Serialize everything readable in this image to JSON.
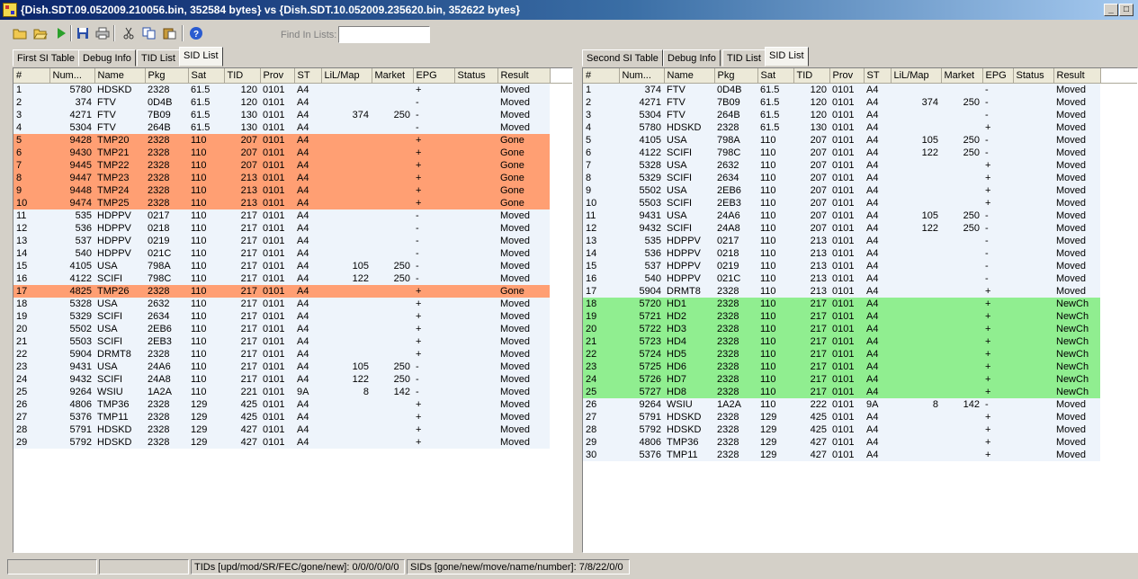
{
  "window": {
    "title": "{Dish.SDT.09.052009.210056.bin, 352584 bytes} vs {Dish.SDT.10.052009.235620.bin, 352622 bytes}",
    "minimize_glyph": "_",
    "maximize_glyph": "□"
  },
  "toolbar": {
    "icons": [
      "open-folder-icon",
      "open-icon",
      "run-icon",
      "save-icon",
      "print-icon",
      "cut-icon",
      "copy-icon",
      "paste-icon",
      "help-icon"
    ],
    "find_label": "Find In Lists:",
    "find_value": ""
  },
  "left_tabs": [
    "First SI Table",
    "Debug Info",
    "TID List",
    "SID List"
  ],
  "right_tabs": [
    "Second SI Table",
    "Debug Info",
    "TID List",
    "SID List"
  ],
  "active_tab": "SID List",
  "columns": [
    "#",
    "Num...",
    "Name",
    "Pkg",
    "Sat",
    "TID",
    "Prov",
    "ST",
    "LiL/Map",
    "Market",
    "EPG",
    "Status",
    "Result"
  ],
  "colors": {
    "gone": "#ff9f73",
    "newch": "#90ee90",
    "normal": "#eef4fb"
  },
  "left_rows": [
    {
      "n": "1",
      "num": "5780",
      "name": "HDSKD",
      "pkg": "2328",
      "sat": "61.5",
      "tid": "120",
      "prov": "0101",
      "st": "A4",
      "lil": "",
      "market": "",
      "epg": "+",
      "status": "",
      "result": "Moved"
    },
    {
      "n": "2",
      "num": "374",
      "name": "FTV",
      "pkg": "0D4B",
      "sat": "61.5",
      "tid": "120",
      "prov": "0101",
      "st": "A4",
      "lil": "",
      "market": "",
      "epg": "-",
      "status": "",
      "result": "Moved"
    },
    {
      "n": "3",
      "num": "4271",
      "name": "FTV",
      "pkg": "7B09",
      "sat": "61.5",
      "tid": "130",
      "prov": "0101",
      "st": "A4",
      "lil": "374",
      "market": "250",
      "epg": "-",
      "status": "",
      "result": "Moved"
    },
    {
      "n": "4",
      "num": "5304",
      "name": "FTV",
      "pkg": "264B",
      "sat": "61.5",
      "tid": "130",
      "prov": "0101",
      "st": "A4",
      "lil": "",
      "market": "",
      "epg": "-",
      "status": "",
      "result": "Moved"
    },
    {
      "n": "5",
      "num": "9428",
      "name": "TMP20",
      "pkg": "2328",
      "sat": "110",
      "tid": "207",
      "prov": "0101",
      "st": "A4",
      "lil": "",
      "market": "",
      "epg": "+",
      "status": "",
      "result": "Gone"
    },
    {
      "n": "6",
      "num": "9430",
      "name": "TMP21",
      "pkg": "2328",
      "sat": "110",
      "tid": "207",
      "prov": "0101",
      "st": "A4",
      "lil": "",
      "market": "",
      "epg": "+",
      "status": "",
      "result": "Gone"
    },
    {
      "n": "7",
      "num": "9445",
      "name": "TMP22",
      "pkg": "2328",
      "sat": "110",
      "tid": "207",
      "prov": "0101",
      "st": "A4",
      "lil": "",
      "market": "",
      "epg": "+",
      "status": "",
      "result": "Gone"
    },
    {
      "n": "8",
      "num": "9447",
      "name": "TMP23",
      "pkg": "2328",
      "sat": "110",
      "tid": "213",
      "prov": "0101",
      "st": "A4",
      "lil": "",
      "market": "",
      "epg": "+",
      "status": "",
      "result": "Gone"
    },
    {
      "n": "9",
      "num": "9448",
      "name": "TMP24",
      "pkg": "2328",
      "sat": "110",
      "tid": "213",
      "prov": "0101",
      "st": "A4",
      "lil": "",
      "market": "",
      "epg": "+",
      "status": "",
      "result": "Gone"
    },
    {
      "n": "10",
      "num": "9474",
      "name": "TMP25",
      "pkg": "2328",
      "sat": "110",
      "tid": "213",
      "prov": "0101",
      "st": "A4",
      "lil": "",
      "market": "",
      "epg": "+",
      "status": "",
      "result": "Gone"
    },
    {
      "n": "11",
      "num": "535",
      "name": "HDPPV",
      "pkg": "0217",
      "sat": "110",
      "tid": "217",
      "prov": "0101",
      "st": "A4",
      "lil": "",
      "market": "",
      "epg": "-",
      "status": "",
      "result": "Moved"
    },
    {
      "n": "12",
      "num": "536",
      "name": "HDPPV",
      "pkg": "0218",
      "sat": "110",
      "tid": "217",
      "prov": "0101",
      "st": "A4",
      "lil": "",
      "market": "",
      "epg": "-",
      "status": "",
      "result": "Moved"
    },
    {
      "n": "13",
      "num": "537",
      "name": "HDPPV",
      "pkg": "0219",
      "sat": "110",
      "tid": "217",
      "prov": "0101",
      "st": "A4",
      "lil": "",
      "market": "",
      "epg": "-",
      "status": "",
      "result": "Moved"
    },
    {
      "n": "14",
      "num": "540",
      "name": "HDPPV",
      "pkg": "021C",
      "sat": "110",
      "tid": "217",
      "prov": "0101",
      "st": "A4",
      "lil": "",
      "market": "",
      "epg": "-",
      "status": "",
      "result": "Moved"
    },
    {
      "n": "15",
      "num": "4105",
      "name": "USA",
      "pkg": "798A",
      "sat": "110",
      "tid": "217",
      "prov": "0101",
      "st": "A4",
      "lil": "105",
      "market": "250",
      "epg": "-",
      "status": "",
      "result": "Moved"
    },
    {
      "n": "16",
      "num": "4122",
      "name": "SCIFI",
      "pkg": "798C",
      "sat": "110",
      "tid": "217",
      "prov": "0101",
      "st": "A4",
      "lil": "122",
      "market": "250",
      "epg": "-",
      "status": "",
      "result": "Moved"
    },
    {
      "n": "17",
      "num": "4825",
      "name": "TMP26",
      "pkg": "2328",
      "sat": "110",
      "tid": "217",
      "prov": "0101",
      "st": "A4",
      "lil": "",
      "market": "",
      "epg": "+",
      "status": "",
      "result": "Gone"
    },
    {
      "n": "18",
      "num": "5328",
      "name": "USA",
      "pkg": "2632",
      "sat": "110",
      "tid": "217",
      "prov": "0101",
      "st": "A4",
      "lil": "",
      "market": "",
      "epg": "+",
      "status": "",
      "result": "Moved"
    },
    {
      "n": "19",
      "num": "5329",
      "name": "SCIFI",
      "pkg": "2634",
      "sat": "110",
      "tid": "217",
      "prov": "0101",
      "st": "A4",
      "lil": "",
      "market": "",
      "epg": "+",
      "status": "",
      "result": "Moved"
    },
    {
      "n": "20",
      "num": "5502",
      "name": "USA",
      "pkg": "2EB6",
      "sat": "110",
      "tid": "217",
      "prov": "0101",
      "st": "A4",
      "lil": "",
      "market": "",
      "epg": "+",
      "status": "",
      "result": "Moved"
    },
    {
      "n": "21",
      "num": "5503",
      "name": "SCIFI",
      "pkg": "2EB3",
      "sat": "110",
      "tid": "217",
      "prov": "0101",
      "st": "A4",
      "lil": "",
      "market": "",
      "epg": "+",
      "status": "",
      "result": "Moved"
    },
    {
      "n": "22",
      "num": "5904",
      "name": "DRMT8",
      "pkg": "2328",
      "sat": "110",
      "tid": "217",
      "prov": "0101",
      "st": "A4",
      "lil": "",
      "market": "",
      "epg": "+",
      "status": "",
      "result": "Moved"
    },
    {
      "n": "23",
      "num": "9431",
      "name": "USA",
      "pkg": "24A6",
      "sat": "110",
      "tid": "217",
      "prov": "0101",
      "st": "A4",
      "lil": "105",
      "market": "250",
      "epg": "-",
      "status": "",
      "result": "Moved"
    },
    {
      "n": "24",
      "num": "9432",
      "name": "SCIFI",
      "pkg": "24A8",
      "sat": "110",
      "tid": "217",
      "prov": "0101",
      "st": "A4",
      "lil": "122",
      "market": "250",
      "epg": "-",
      "status": "",
      "result": "Moved"
    },
    {
      "n": "25",
      "num": "9264",
      "name": "WSIU",
      "pkg": "1A2A",
      "sat": "110",
      "tid": "221",
      "prov": "0101",
      "st": "9A",
      "lil": "8",
      "market": "142",
      "epg": "-",
      "status": "",
      "result": "Moved"
    },
    {
      "n": "26",
      "num": "4806",
      "name": "TMP36",
      "pkg": "2328",
      "sat": "129",
      "tid": "425",
      "prov": "0101",
      "st": "A4",
      "lil": "",
      "market": "",
      "epg": "+",
      "status": "",
      "result": "Moved"
    },
    {
      "n": "27",
      "num": "5376",
      "name": "TMP11",
      "pkg": "2328",
      "sat": "129",
      "tid": "425",
      "prov": "0101",
      "st": "A4",
      "lil": "",
      "market": "",
      "epg": "+",
      "status": "",
      "result": "Moved"
    },
    {
      "n": "28",
      "num": "5791",
      "name": "HDSKD",
      "pkg": "2328",
      "sat": "129",
      "tid": "427",
      "prov": "0101",
      "st": "A4",
      "lil": "",
      "market": "",
      "epg": "+",
      "status": "",
      "result": "Moved"
    },
    {
      "n": "29",
      "num": "5792",
      "name": "HDSKD",
      "pkg": "2328",
      "sat": "129",
      "tid": "427",
      "prov": "0101",
      "st": "A4",
      "lil": "",
      "market": "",
      "epg": "+",
      "status": "",
      "result": "Moved"
    }
  ],
  "right_rows": [
    {
      "n": "1",
      "num": "374",
      "name": "FTV",
      "pkg": "0D4B",
      "sat": "61.5",
      "tid": "120",
      "prov": "0101",
      "st": "A4",
      "lil": "",
      "market": "",
      "epg": "-",
      "status": "",
      "result": "Moved"
    },
    {
      "n": "2",
      "num": "4271",
      "name": "FTV",
      "pkg": "7B09",
      "sat": "61.5",
      "tid": "120",
      "prov": "0101",
      "st": "A4",
      "lil": "374",
      "market": "250",
      "epg": "-",
      "status": "",
      "result": "Moved"
    },
    {
      "n": "3",
      "num": "5304",
      "name": "FTV",
      "pkg": "264B",
      "sat": "61.5",
      "tid": "120",
      "prov": "0101",
      "st": "A4",
      "lil": "",
      "market": "",
      "epg": "-",
      "status": "",
      "result": "Moved"
    },
    {
      "n": "4",
      "num": "5780",
      "name": "HDSKD",
      "pkg": "2328",
      "sat": "61.5",
      "tid": "130",
      "prov": "0101",
      "st": "A4",
      "lil": "",
      "market": "",
      "epg": "+",
      "status": "",
      "result": "Moved"
    },
    {
      "n": "5",
      "num": "4105",
      "name": "USA",
      "pkg": "798A",
      "sat": "110",
      "tid": "207",
      "prov": "0101",
      "st": "A4",
      "lil": "105",
      "market": "250",
      "epg": "-",
      "status": "",
      "result": "Moved"
    },
    {
      "n": "6",
      "num": "4122",
      "name": "SCIFI",
      "pkg": "798C",
      "sat": "110",
      "tid": "207",
      "prov": "0101",
      "st": "A4",
      "lil": "122",
      "market": "250",
      "epg": "-",
      "status": "",
      "result": "Moved"
    },
    {
      "n": "7",
      "num": "5328",
      "name": "USA",
      "pkg": "2632",
      "sat": "110",
      "tid": "207",
      "prov": "0101",
      "st": "A4",
      "lil": "",
      "market": "",
      "epg": "+",
      "status": "",
      "result": "Moved"
    },
    {
      "n": "8",
      "num": "5329",
      "name": "SCIFI",
      "pkg": "2634",
      "sat": "110",
      "tid": "207",
      "prov": "0101",
      "st": "A4",
      "lil": "",
      "market": "",
      "epg": "+",
      "status": "",
      "result": "Moved"
    },
    {
      "n": "9",
      "num": "5502",
      "name": "USA",
      "pkg": "2EB6",
      "sat": "110",
      "tid": "207",
      "prov": "0101",
      "st": "A4",
      "lil": "",
      "market": "",
      "epg": "+",
      "status": "",
      "result": "Moved"
    },
    {
      "n": "10",
      "num": "5503",
      "name": "SCIFI",
      "pkg": "2EB3",
      "sat": "110",
      "tid": "207",
      "prov": "0101",
      "st": "A4",
      "lil": "",
      "market": "",
      "epg": "+",
      "status": "",
      "result": "Moved"
    },
    {
      "n": "11",
      "num": "9431",
      "name": "USA",
      "pkg": "24A6",
      "sat": "110",
      "tid": "207",
      "prov": "0101",
      "st": "A4",
      "lil": "105",
      "market": "250",
      "epg": "-",
      "status": "",
      "result": "Moved"
    },
    {
      "n": "12",
      "num": "9432",
      "name": "SCIFI",
      "pkg": "24A8",
      "sat": "110",
      "tid": "207",
      "prov": "0101",
      "st": "A4",
      "lil": "122",
      "market": "250",
      "epg": "-",
      "status": "",
      "result": "Moved"
    },
    {
      "n": "13",
      "num": "535",
      "name": "HDPPV",
      "pkg": "0217",
      "sat": "110",
      "tid": "213",
      "prov": "0101",
      "st": "A4",
      "lil": "",
      "market": "",
      "epg": "-",
      "status": "",
      "result": "Moved"
    },
    {
      "n": "14",
      "num": "536",
      "name": "HDPPV",
      "pkg": "0218",
      "sat": "110",
      "tid": "213",
      "prov": "0101",
      "st": "A4",
      "lil": "",
      "market": "",
      "epg": "-",
      "status": "",
      "result": "Moved"
    },
    {
      "n": "15",
      "num": "537",
      "name": "HDPPV",
      "pkg": "0219",
      "sat": "110",
      "tid": "213",
      "prov": "0101",
      "st": "A4",
      "lil": "",
      "market": "",
      "epg": "-",
      "status": "",
      "result": "Moved"
    },
    {
      "n": "16",
      "num": "540",
      "name": "HDPPV",
      "pkg": "021C",
      "sat": "110",
      "tid": "213",
      "prov": "0101",
      "st": "A4",
      "lil": "",
      "market": "",
      "epg": "-",
      "status": "",
      "result": "Moved"
    },
    {
      "n": "17",
      "num": "5904",
      "name": "DRMT8",
      "pkg": "2328",
      "sat": "110",
      "tid": "213",
      "prov": "0101",
      "st": "A4",
      "lil": "",
      "market": "",
      "epg": "+",
      "status": "",
      "result": "Moved"
    },
    {
      "n": "18",
      "num": "5720",
      "name": "HD1",
      "pkg": "2328",
      "sat": "110",
      "tid": "217",
      "prov": "0101",
      "st": "A4",
      "lil": "",
      "market": "",
      "epg": "+",
      "status": "",
      "result": "NewCh"
    },
    {
      "n": "19",
      "num": "5721",
      "name": "HD2",
      "pkg": "2328",
      "sat": "110",
      "tid": "217",
      "prov": "0101",
      "st": "A4",
      "lil": "",
      "market": "",
      "epg": "+",
      "status": "",
      "result": "NewCh"
    },
    {
      "n": "20",
      "num": "5722",
      "name": "HD3",
      "pkg": "2328",
      "sat": "110",
      "tid": "217",
      "prov": "0101",
      "st": "A4",
      "lil": "",
      "market": "",
      "epg": "+",
      "status": "",
      "result": "NewCh"
    },
    {
      "n": "21",
      "num": "5723",
      "name": "HD4",
      "pkg": "2328",
      "sat": "110",
      "tid": "217",
      "prov": "0101",
      "st": "A4",
      "lil": "",
      "market": "",
      "epg": "+",
      "status": "",
      "result": "NewCh"
    },
    {
      "n": "22",
      "num": "5724",
      "name": "HD5",
      "pkg": "2328",
      "sat": "110",
      "tid": "217",
      "prov": "0101",
      "st": "A4",
      "lil": "",
      "market": "",
      "epg": "+",
      "status": "",
      "result": "NewCh"
    },
    {
      "n": "23",
      "num": "5725",
      "name": "HD6",
      "pkg": "2328",
      "sat": "110",
      "tid": "217",
      "prov": "0101",
      "st": "A4",
      "lil": "",
      "market": "",
      "epg": "+",
      "status": "",
      "result": "NewCh"
    },
    {
      "n": "24",
      "num": "5726",
      "name": "HD7",
      "pkg": "2328",
      "sat": "110",
      "tid": "217",
      "prov": "0101",
      "st": "A4",
      "lil": "",
      "market": "",
      "epg": "+",
      "status": "",
      "result": "NewCh"
    },
    {
      "n": "25",
      "num": "5727",
      "name": "HD8",
      "pkg": "2328",
      "sat": "110",
      "tid": "217",
      "prov": "0101",
      "st": "A4",
      "lil": "",
      "market": "",
      "epg": "+",
      "status": "",
      "result": "NewCh"
    },
    {
      "n": "26",
      "num": "9264",
      "name": "WSIU",
      "pkg": "1A2A",
      "sat": "110",
      "tid": "222",
      "prov": "0101",
      "st": "9A",
      "lil": "8",
      "market": "142",
      "epg": "-",
      "status": "",
      "result": "Moved"
    },
    {
      "n": "27",
      "num": "5791",
      "name": "HDSKD",
      "pkg": "2328",
      "sat": "129",
      "tid": "425",
      "prov": "0101",
      "st": "A4",
      "lil": "",
      "market": "",
      "epg": "+",
      "status": "",
      "result": "Moved"
    },
    {
      "n": "28",
      "num": "5792",
      "name": "HDSKD",
      "pkg": "2328",
      "sat": "129",
      "tid": "425",
      "prov": "0101",
      "st": "A4",
      "lil": "",
      "market": "",
      "epg": "+",
      "status": "",
      "result": "Moved"
    },
    {
      "n": "29",
      "num": "4806",
      "name": "TMP36",
      "pkg": "2328",
      "sat": "129",
      "tid": "427",
      "prov": "0101",
      "st": "A4",
      "lil": "",
      "market": "",
      "epg": "+",
      "status": "",
      "result": "Moved"
    },
    {
      "n": "30",
      "num": "5376",
      "name": "TMP11",
      "pkg": "2328",
      "sat": "129",
      "tid": "427",
      "prov": "0101",
      "st": "A4",
      "lil": "",
      "market": "",
      "epg": "+",
      "status": "",
      "result": "Moved"
    }
  ],
  "status": {
    "panel1": "",
    "panel2": "",
    "tids": "TIDs [upd/mod/SR/FEC/gone/new]: 0/0/0/0/0/0",
    "sids": "SIDs [gone/new/move/name/number]: 7/8/22/0/0"
  }
}
